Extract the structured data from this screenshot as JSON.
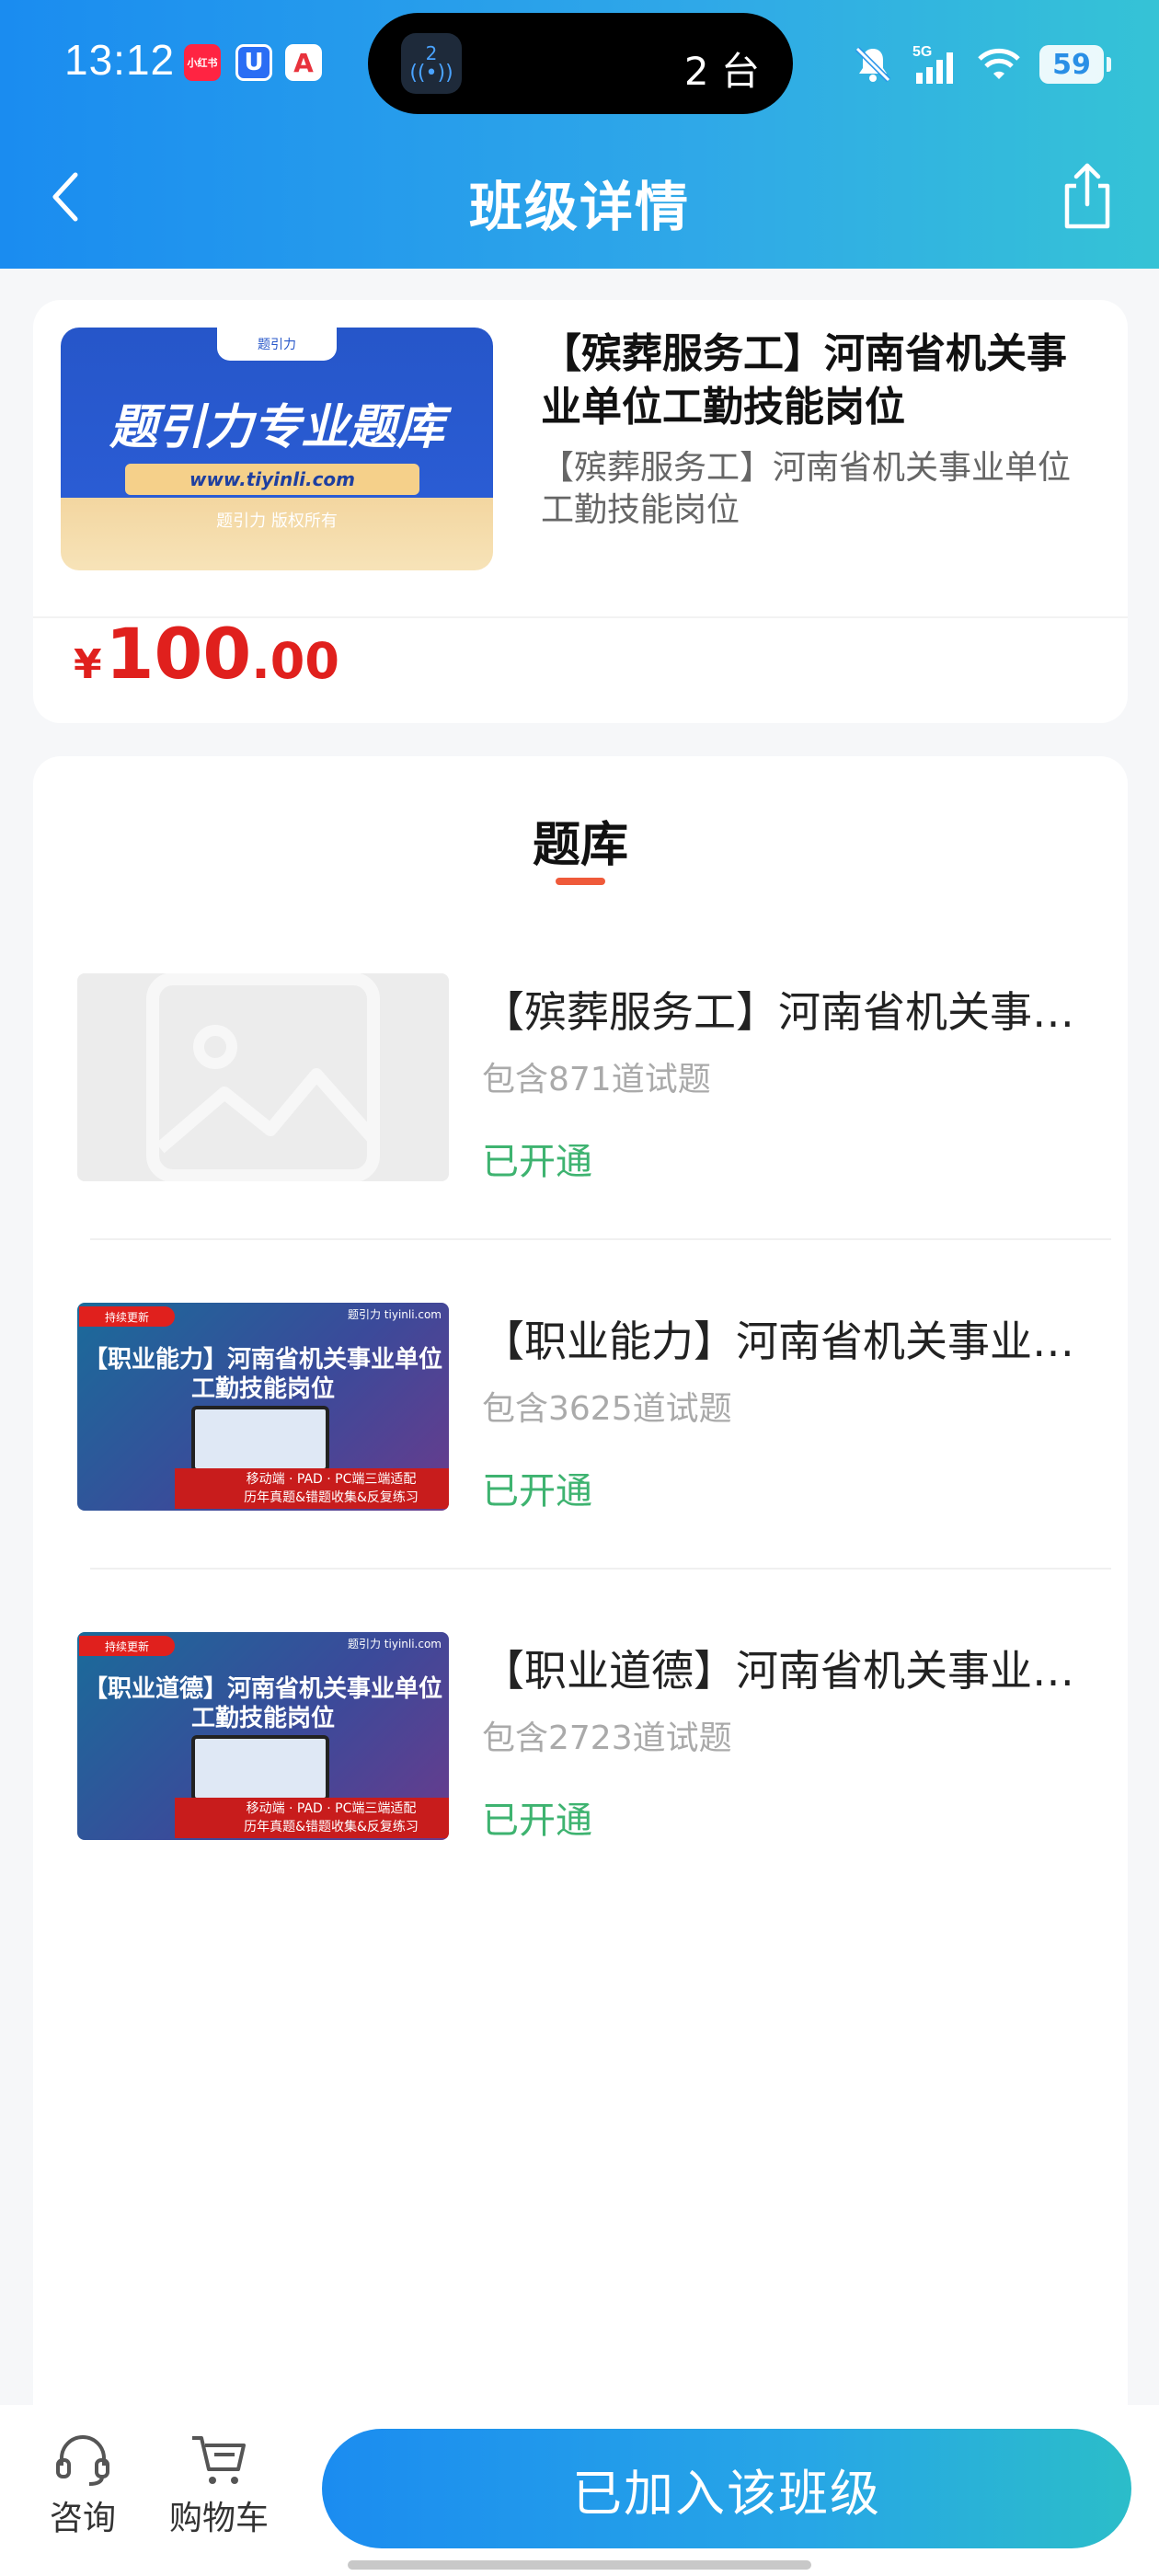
{
  "status_bar": {
    "time": "13:12",
    "notif_apps": [
      "小红书",
      "U",
      "A"
    ],
    "island_badge": "2",
    "island_text": "2 台",
    "network": "5G",
    "battery": "59"
  },
  "nav": {
    "title": "班级详情"
  },
  "product": {
    "cover_tab": "题引力",
    "cover_title": "题引力专业题库",
    "cover_url": "www.tiyinli.com",
    "cover_copyright": "题引力 版权所有",
    "title": "【殡葬服务工】河南省机关事业单位工勤技能岗位",
    "subtitle": "【殡葬服务工】河南省机关事业单位工勤技能岗位",
    "price": {
      "currency": "¥",
      "integer": "100",
      "decimal": ".00"
    }
  },
  "bank": {
    "heading": "题库",
    "items": [
      {
        "name": "【殡葬服务工】河南省机关事业单位工勤技能岗位",
        "count": "包含871道试题",
        "status": "已开通",
        "thumb": "placeholder"
      },
      {
        "name": "【职业能力】河南省机关事业单位工勤技能岗位",
        "count": "包含3625道试题",
        "status": "已开通",
        "thumb": "poster",
        "poster_badge": "持续更新",
        "poster_logo": "题引力 tiyinli.com",
        "poster_title_line1": "【职业能力】河南省机关事业单位",
        "poster_title_line2": "工勤技能岗位",
        "poster_bar_line1": "移动端 · PAD · PC端三端适配",
        "poster_bar_line2": "历年真题&错题收集&反复练习"
      },
      {
        "name": "【职业道德】河南省机关事业单位工勤技能岗位",
        "count": "包含2723道试题",
        "status": "已开通",
        "thumb": "poster",
        "poster_badge": "持续更新",
        "poster_logo": "题引力 tiyinli.com",
        "poster_title_line1": "【职业道德】河南省机关事业单位",
        "poster_title_line2": "工勤技能岗位",
        "poster_bar_line1": "移动端 · PAD · PC端三端适配",
        "poster_bar_line2": "历年真题&错题收集&反复练习"
      }
    ]
  },
  "bottom_bar": {
    "consult_label": "咨询",
    "cart_label": "购物车",
    "join_label": "已加入该班级"
  },
  "colors": {
    "header_start": "#1a8cf0",
    "header_end": "#35c3d6",
    "price": "#e0201d",
    "opened": "#3eb370",
    "tab_indicator": "#ef5a3a"
  },
  "icons": [
    "back-icon",
    "share-icon",
    "headset-icon",
    "cart-icon",
    "image-placeholder-icon",
    "mute-icon",
    "signal-icon",
    "wifi-icon"
  ]
}
